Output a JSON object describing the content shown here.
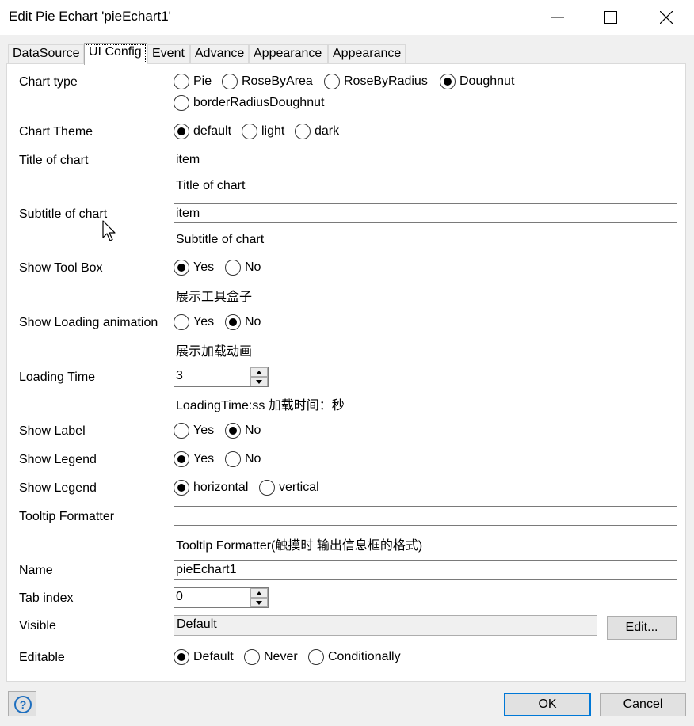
{
  "window": {
    "title": "Edit Pie Echart 'pieEchart1'"
  },
  "tabs": [
    "DataSource",
    "UI Config",
    "Event",
    "Advance",
    "Appearance",
    "Appearance"
  ],
  "chart_type": {
    "label": "Chart type",
    "options": [
      "Pie",
      "RoseByArea",
      "RoseByRadius",
      "Doughnut",
      "borderRadiusDoughnut"
    ],
    "selected": "Doughnut"
  },
  "chart_theme": {
    "label": "Chart Theme",
    "options": [
      "default",
      "light",
      "dark"
    ],
    "selected": "default"
  },
  "title_of_chart": {
    "label": "Title of chart",
    "value": "item",
    "hint": "Title of chart"
  },
  "subtitle_of_chart": {
    "label": "Subtitle of chart",
    "value": "item",
    "hint": "Subtitle of chart"
  },
  "show_tool_box": {
    "label": "Show Tool Box",
    "options": [
      "Yes",
      "No"
    ],
    "selected": "Yes",
    "hint": "展示工具盒子"
  },
  "show_loading_animation": {
    "label": "Show Loading animation",
    "options": [
      "Yes",
      "No"
    ],
    "selected": "No",
    "hint": "展示加载动画"
  },
  "loading_time": {
    "label": "Loading Time",
    "value": "3",
    "hint": "LoadingTime:ss 加载时间：秒"
  },
  "show_label": {
    "label": "Show Label",
    "options": [
      "Yes",
      "No"
    ],
    "selected": "No"
  },
  "show_legend": {
    "label": "Show Legend",
    "options": [
      "Yes",
      "No"
    ],
    "selected": "Yes"
  },
  "legend_orient": {
    "label": "Show Legend",
    "options": [
      "horizontal",
      "vertical"
    ],
    "selected": "horizontal"
  },
  "tooltip_formatter": {
    "label": "Tooltip Formatter",
    "value": "",
    "hint": "Tooltip  Formatter(触摸时 输出信息框的格式)"
  },
  "name": {
    "label": "Name",
    "value": "pieEchart1"
  },
  "tab_index": {
    "label": "Tab index",
    "value": "0"
  },
  "visible": {
    "label": "Visible",
    "value": "Default",
    "edit_label": "Edit..."
  },
  "editable": {
    "label": "Editable",
    "options": [
      "Default",
      "Never",
      "Conditionally"
    ],
    "selected": "Default"
  },
  "footer": {
    "ok_label": "OK",
    "cancel_label": "Cancel"
  },
  "icons": {
    "help": "help-icon",
    "minimize": "minimize-icon",
    "maximize": "maximize-icon",
    "close": "close-icon",
    "cursor": "mouse-pointer-icon"
  },
  "colors": {
    "accent": "#0078d7",
    "help_icon": "#1e6fbf"
  }
}
